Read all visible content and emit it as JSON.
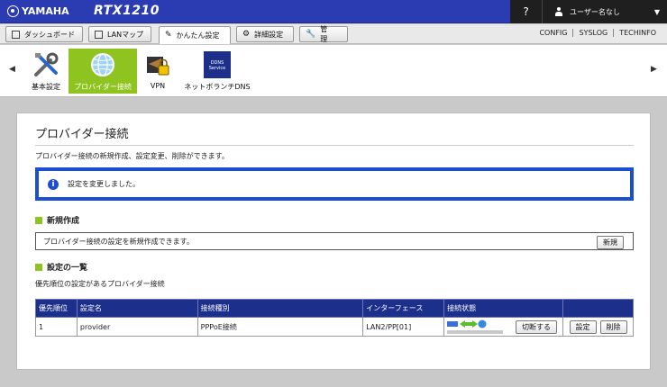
{
  "header": {
    "brand": "YAMAHA",
    "model": "RTX1210",
    "help": "?",
    "user": "ユーザー名なし"
  },
  "tabs": [
    {
      "label": "ダッシュボード"
    },
    {
      "label": "LANマップ"
    },
    {
      "label": "かんたん設定"
    },
    {
      "label": "詳細設定"
    },
    {
      "label": "管　理"
    }
  ],
  "toplinks": [
    "CONFIG",
    "SYSLOG",
    "TECHINFO"
  ],
  "iconbar": [
    {
      "label": "基本設定"
    },
    {
      "label": "プロバイダー接続"
    },
    {
      "label": "VPN"
    },
    {
      "label": "ネットボランチDNS"
    }
  ],
  "ddns_icon_text": "DDNS Service",
  "page": {
    "title": "プロバイダー接続",
    "description": "プロバイダー接続の新規作成、設定変更、削除ができます。",
    "notice": "設定を変更しました。",
    "new_section": {
      "heading": "新規作成",
      "text": "プロバイダー接続の設定を新規作成できます。",
      "button": "新規"
    },
    "list_section": {
      "heading": "設定の一覧",
      "subtitle": "優先順位の設定があるプロバイダー接続"
    }
  },
  "table": {
    "headers": [
      "優先順位",
      "設定名",
      "接続種別",
      "インターフェース",
      "接続状態",
      ""
    ],
    "rows": [
      {
        "priority": "1",
        "name": "provider",
        "type": "PPPoE接続",
        "interface": "LAN2/PP[01]",
        "disconnect": "切断する",
        "edit": "設定",
        "delete": "削除"
      }
    ]
  },
  "colors": {
    "header_bg": "#2b3bb1",
    "accent_green": "#8fc31f",
    "notice_border": "#1c4fd0",
    "table_header": "#1c2f8a"
  }
}
